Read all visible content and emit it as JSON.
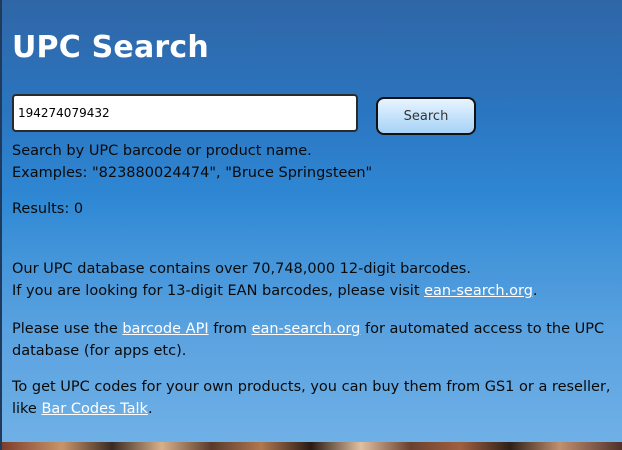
{
  "page": {
    "title": "UPC Search"
  },
  "search": {
    "value": "194274079432",
    "button_label": "Search",
    "hint_line1": "Search by UPC barcode or product name.",
    "hint_line2": "Examples: \"823880024474\", \"Bruce Springsteen\""
  },
  "results": {
    "label": "Results: 0"
  },
  "info": {
    "db_line": "Our UPC database contains over 70,748,000 12-digit barcodes.",
    "ean_prefix": "If you are looking for 13-digit EAN barcodes, please visit ",
    "ean_link": "ean-search.org",
    "ean_suffix": ".",
    "api_prefix": "Please use the ",
    "api_link": "barcode API",
    "api_mid": " from ",
    "api_site_link": "ean-search.org",
    "api_suffix": " for automated access to the UPC database (for apps etc).",
    "gs1_prefix": "To get UPC codes for your own products, you can buy them from GS1 or a reseller, like ",
    "gs1_link": "Bar Codes Talk",
    "gs1_suffix": "."
  },
  "colors": {
    "panel_top": "#2f66a6",
    "panel_bottom": "#6fb0e6",
    "link": "#ffffff",
    "title": "#ffffff"
  }
}
